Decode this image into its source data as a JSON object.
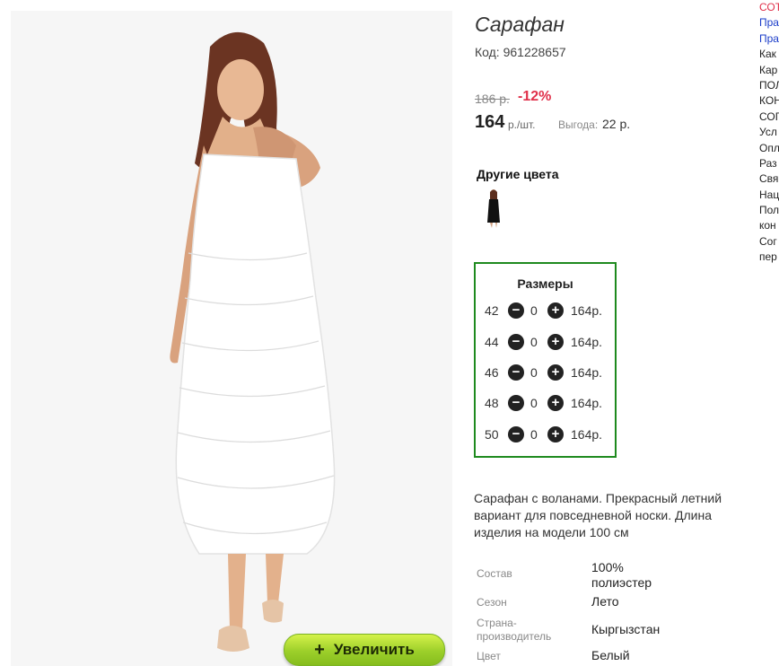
{
  "product": {
    "title": "Сарафан",
    "code": "Код: 961228657",
    "old_price": "186 р.",
    "discount": "-12%",
    "price": "164",
    "unit": "р./шт.",
    "benefit_label": "Выгода:",
    "benefit_value": "22 р.",
    "other_colors_label": "Другие цвета",
    "zoom_button_label": "Увеличить",
    "zoom_button_icon": "+"
  },
  "sizes": {
    "title": "Размеры",
    "rows": [
      {
        "size": "42",
        "qty": "0",
        "price": "164р."
      },
      {
        "size": "44",
        "qty": "0",
        "price": "164р."
      },
      {
        "size": "46",
        "qty": "0",
        "price": "164р."
      },
      {
        "size": "48",
        "qty": "0",
        "price": "164р."
      },
      {
        "size": "50",
        "qty": "0",
        "price": "164р."
      }
    ],
    "minus_icon": "−",
    "plus_icon": "+"
  },
  "description": "Сарафан с воланами. Прекрасный летний вариант для повседневной носки. Длина изделия на модели 100 см",
  "specs": [
    {
      "label": "Состав",
      "value": "100% полиэстер"
    },
    {
      "label": "Сезон",
      "value": "Лето"
    },
    {
      "label": "Страна-производитель",
      "value": "Кыргызстан"
    },
    {
      "label": "Цвет",
      "value": "Белый"
    }
  ],
  "side_menu": [
    "СОТ",
    "Пра",
    "Пра",
    "Как",
    "Кар",
    "ПОЛ",
    "КОН",
    "СОГ",
    "Усл",
    "Опл",
    "Раз",
    "Свя",
    "Нац",
    "Пол",
    "кон",
    "Сог",
    "пер"
  ],
  "colors": {
    "accent_green": "#1e8a1e",
    "discount_red": "#e0304a",
    "link_blue": "#1a3cc9",
    "zoom_button_green": "#9ccf2a"
  }
}
